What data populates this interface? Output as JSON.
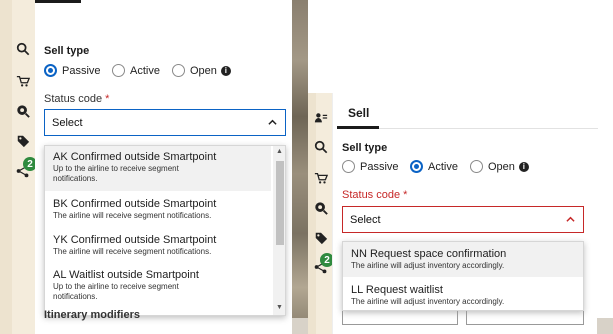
{
  "left": {
    "sell_type_label": "Sell type",
    "radios": [
      {
        "label": "Passive",
        "selected": true
      },
      {
        "label": "Active",
        "selected": false
      },
      {
        "label": "Open",
        "selected": false,
        "info_icon": true
      }
    ],
    "status_code_label": "Status code",
    "required_mark": "*",
    "select_value": "Select",
    "dropdown_items": [
      {
        "title": "AK Confirmed outside Smartpoint",
        "subtitle": "Up to the airline to receive segment notifications."
      },
      {
        "title": "BK Confirmed outside Smartpoint",
        "subtitle": "The airline will receive segment notifications."
      },
      {
        "title": "YK Confirmed outside Smartpoint",
        "subtitle": "The airline will receive segment notifications."
      },
      {
        "title": "AL Waitlist outside Smartpoint",
        "subtitle": "Up to the airline to receive segment notifications."
      }
    ],
    "behind_text": "Itinerary modifiers",
    "badge_count": "2"
  },
  "right": {
    "tab_label": "Sell",
    "sell_type_label": "Sell type",
    "radios": [
      {
        "label": "Passive",
        "selected": false
      },
      {
        "label": "Active",
        "selected": true
      },
      {
        "label": "Open",
        "selected": false,
        "info_icon": true
      }
    ],
    "status_code_label": "Status code",
    "required_mark": "*",
    "select_value": "Select",
    "dropdown_items": [
      {
        "title": "NN Request space confirmation",
        "subtitle": "The airline will adjust inventory accordingly."
      },
      {
        "title": "LL Request waitlist",
        "subtitle": "The airline will adjust inventory accordingly."
      }
    ],
    "badge_count": "2"
  },
  "colors": {
    "accent": "#0b63c5",
    "error": "#c62828",
    "badge": "#2f8a3e",
    "rail": "#f4ecdc"
  },
  "icons": [
    "traveler-icon",
    "search-icon",
    "cart-icon",
    "zoom-icon",
    "tag-icon",
    "share-icon",
    "chevron-up-icon",
    "info-icon"
  ]
}
